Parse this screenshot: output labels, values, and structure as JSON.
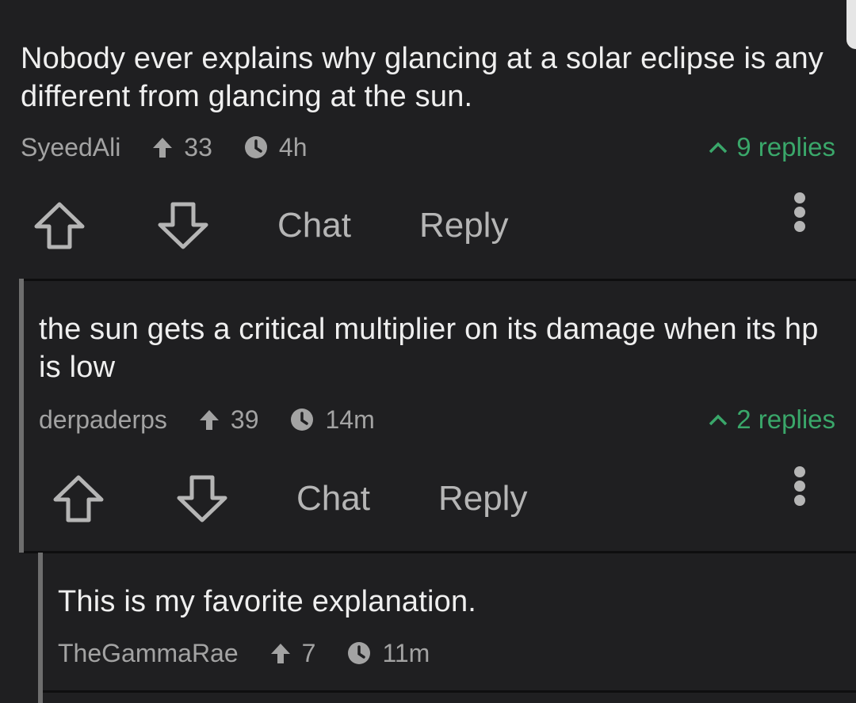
{
  "comments": [
    {
      "body": "Nobody ever explains why glancing at a solar eclipse is any different from glancing at the sun.",
      "author": "SyeedAli",
      "score": "33",
      "age": "4h",
      "replies": "9 replies",
      "actions": {
        "chat": "Chat",
        "reply": "Reply"
      }
    },
    {
      "body": "the sun gets a critical multiplier on its damage when its hp is low",
      "author": "derpaderps",
      "score": "39",
      "age": "14m",
      "replies": "2 replies",
      "actions": {
        "chat": "Chat",
        "reply": "Reply"
      }
    },
    {
      "body": "This is my favorite explanation.",
      "author": "TheGammaRae",
      "score": "7",
      "age": "11m"
    }
  ],
  "colors": {
    "background": "#1f1f21",
    "replies_accent": "#3aa76a",
    "thread_line": "#6e6e6e"
  },
  "icons": [
    "upvote-arrow-icon",
    "downvote-arrow-icon",
    "clock-icon",
    "caret-up-icon",
    "more-vertical-icon",
    "score-arrow-icon"
  ]
}
